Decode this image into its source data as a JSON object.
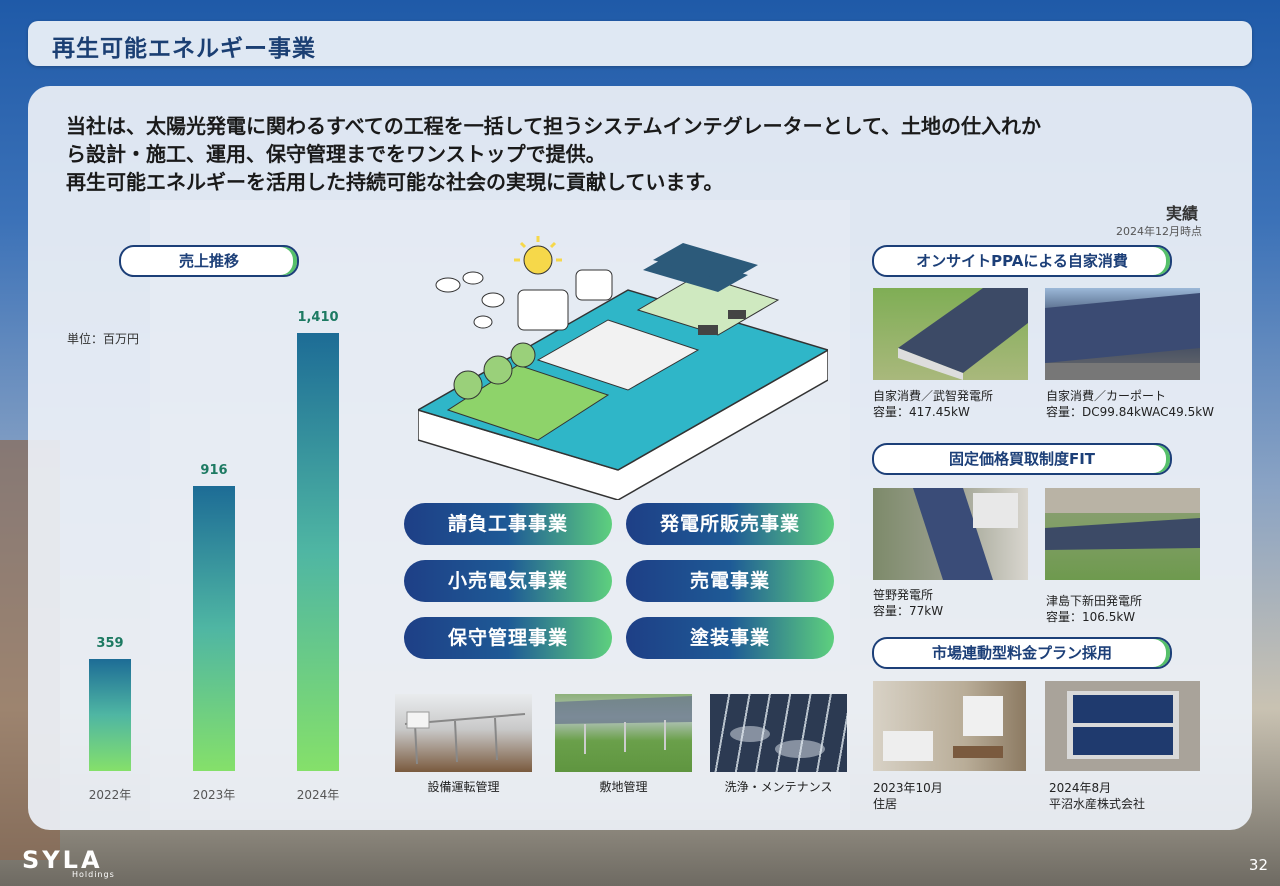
{
  "header": {
    "title": "再生可能エネルギー事業"
  },
  "intro": {
    "line1": "当社は、太陽光発電に関わるすべての工程を一括して担うシステムインテグレーターとして、土地の仕入れか",
    "line2": "ら設計・施工、運用、保守管理までをワンストップで提供。",
    "line3": "再生可能エネルギーを活用した持続可能な社会の実現に貢献しています。"
  },
  "achievements": {
    "label": "実績",
    "as_of": "2024年12月時点"
  },
  "sales": {
    "title": "売上推移",
    "unit": "単位：百万円"
  },
  "chart_data": {
    "type": "bar",
    "categories": [
      "2022年",
      "2023年",
      "2024年"
    ],
    "values": [
      359,
      916,
      1410
    ],
    "value_labels": [
      "359",
      "916",
      "1,410"
    ],
    "ylabel": "単位：百万円",
    "ylim": [
      0,
      1410
    ],
    "bar_gradient": [
      "#1d6c96",
      "#85e06a"
    ]
  },
  "services": [
    "請負工事事業",
    "発電所販売事業",
    "小売電気事業",
    "売電事業",
    "保守管理事業",
    "塗装事業"
  ],
  "maintenance_photos": [
    {
      "caption": "設備運転管理"
    },
    {
      "caption": "敷地管理"
    },
    {
      "caption": "洗浄・メンテナンス"
    }
  ],
  "ppa": {
    "title": "オンサイトPPAによる自家消費",
    "items": [
      {
        "name": "自家消費／武智発電所",
        "capacity": "容量：417.45kW"
      },
      {
        "name": "自家消費／カーポート",
        "capacity": "容量：DC99.84kWAC49.5kW"
      }
    ]
  },
  "fit": {
    "title": "固定価格買取制度FIT",
    "items": [
      {
        "name": "笹野発電所",
        "capacity": "容量：77kW"
      },
      {
        "name": "津島下新田発電所",
        "capacity": "容量：106.5kW"
      }
    ]
  },
  "market": {
    "title": "市場連動型料金プラン採用",
    "items": [
      {
        "date": "2023年10月",
        "label": "住居"
      },
      {
        "date": "2024年8月",
        "label": "平沼水産株式会社"
      }
    ]
  },
  "footer": {
    "logo": "SYLA",
    "logo_sub": "Holdings",
    "page": "32"
  },
  "colors": {
    "navy": "#1c3f78",
    "green": "#56c06a",
    "teal": "#1d6c96"
  }
}
